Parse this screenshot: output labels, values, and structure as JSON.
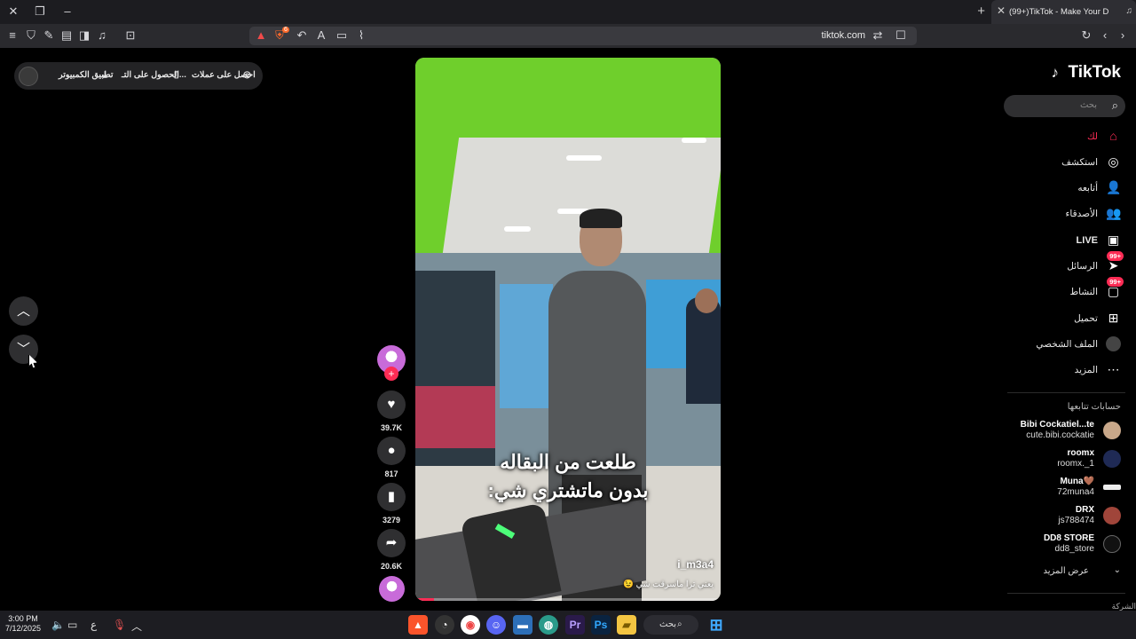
{
  "browser": {
    "tab_title": "(99+)TikTok - Make Your Day",
    "url": "tiktok.com",
    "extension_badge": "6"
  },
  "top_pill": {
    "coins": "احصل على عملات",
    "get_app": "الحصول على التـ...",
    "desktop_app": "تطبيق الكمبيوتر"
  },
  "video": {
    "caption_line1": "طلعت من البقاله",
    "caption_line2": "بدون ماتشتري شي:",
    "username": "i_m3a4",
    "description": "يعني ترا ماسرقت شي 😉",
    "progress_fraction": 0.06
  },
  "actions": {
    "likes": "39.7K",
    "comments": "817",
    "saves": "3279",
    "shares": "20.6K"
  },
  "sidebar": {
    "logo": "TikTok",
    "search_placeholder": "بحث",
    "nav": [
      {
        "label": "لك",
        "icon": "home-icon"
      },
      {
        "label": "استكشف",
        "icon": "compass-icon"
      },
      {
        "label": "أتابعه",
        "icon": "following-icon"
      },
      {
        "label": "الأصدقاء",
        "icon": "friends-icon"
      },
      {
        "label": "LIVE",
        "icon": "live-icon"
      },
      {
        "label": "الرسائل",
        "icon": "messages-icon",
        "badge": "99+"
      },
      {
        "label": "النشاط",
        "icon": "activity-icon",
        "badge": "99+"
      },
      {
        "label": "تحميل",
        "icon": "upload-icon"
      },
      {
        "label": "الملف الشخصي",
        "icon": "profile-avatar-icon"
      },
      {
        "label": "المزيد",
        "icon": "more-icon"
      }
    ],
    "following_title": "حسابات تتابعها",
    "accounts": [
      {
        "name": "Bibi Cockatiel...te",
        "handle": "cute.bibi.cockatie"
      },
      {
        "name": "roomx",
        "handle": "roomx._1"
      },
      {
        "name": "Muna🤎",
        "handle": "72muna4"
      },
      {
        "name": "DRX",
        "handle": "js788474"
      },
      {
        "name": "DD8 STORE",
        "handle": "dd8_store"
      }
    ],
    "see_more": "عرض المزيد",
    "company": "الشركة"
  },
  "taskbar": {
    "time": "3:00 PM",
    "date": "7/12/2025",
    "lang": "ع",
    "search": "بحث"
  },
  "colors": {
    "accent": "#fe2c55",
    "background": "#000000",
    "surface": "#2f2f31"
  }
}
